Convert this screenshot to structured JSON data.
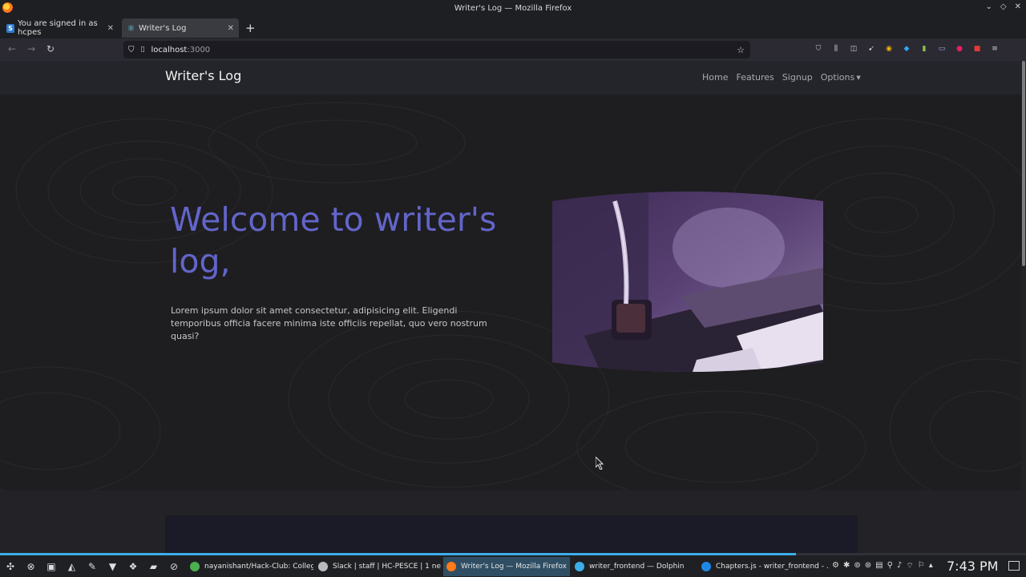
{
  "window": {
    "title": "Writer's Log — Mozilla Firefox",
    "controls": [
      "⌄",
      "◇",
      "✕"
    ]
  },
  "tabs": [
    {
      "label": "You are signed in as hcpes",
      "favicon": "S",
      "active": false
    },
    {
      "label": "Writer's Log",
      "favicon": "⚛",
      "active": true
    }
  ],
  "new_tab_label": "+",
  "toolbar": {
    "back": "←",
    "forward": "→",
    "reload": "↻",
    "url_host": "localhost",
    "url_port": ":3000",
    "shield_icon": "⛉",
    "page_icon": "▯",
    "star_icon": "☆"
  },
  "extensions": [
    {
      "glyph": "⛉",
      "color": "#cccccc"
    },
    {
      "glyph": "⫼",
      "color": "#cccccc"
    },
    {
      "glyph": "◫",
      "color": "#cccccc"
    },
    {
      "glyph": "➹",
      "color": "#cccccc"
    },
    {
      "glyph": "◉",
      "color": "#f0b400"
    },
    {
      "glyph": "◆",
      "color": "#36a3f7"
    },
    {
      "glyph": "▮",
      "color": "#8bc34a"
    },
    {
      "glyph": "▭",
      "color": "#9fa8da"
    },
    {
      "glyph": "●",
      "color": "#e91e63"
    },
    {
      "glyph": "■",
      "color": "#e53935"
    },
    {
      "glyph": "≡",
      "color": "#cccccc"
    }
  ],
  "site": {
    "brand": "Writer's Log",
    "nav": [
      {
        "label": "Home"
      },
      {
        "label": "Features"
      },
      {
        "label": "Signup"
      },
      {
        "label": "Options"
      }
    ],
    "hero_title": "Welcome to writer's log,",
    "hero_text": "Lorem ipsum dolor sit amet consectetur, adipisicing elit. Eligendi temporibus officia facere minima iste officiis repellat, quo vero nostrum quasi?"
  },
  "taskbar": {
    "launchers": [
      "✣",
      "⊗",
      "▣",
      "◭",
      "✎",
      "▼",
      "❖",
      "▰",
      "⊘"
    ],
    "tasks": [
      {
        "label": "nayanishant/Hack-Club: Colleg...",
        "icon_color": "#4caf50"
      },
      {
        "label": "Slack | staff | HC-PESCE | 1 ne...",
        "icon_color": "#bbbbbb"
      },
      {
        "label": "Writer's Log — Mozilla Firefox",
        "icon_color": "#ff7b1a",
        "current": true
      },
      {
        "label": "writer_frontend — Dolphin",
        "icon_color": "#3daee9"
      },
      {
        "label": "Chapters.js - writer_frontend - ...",
        "icon_color": "#1e88e5"
      }
    ],
    "tray": [
      "⚙",
      "✱",
      "⊚",
      "⊛",
      "▤",
      "⚲",
      "♪",
      "⌔",
      "⚐",
      "▴"
    ],
    "clock": "7:43 PM"
  }
}
